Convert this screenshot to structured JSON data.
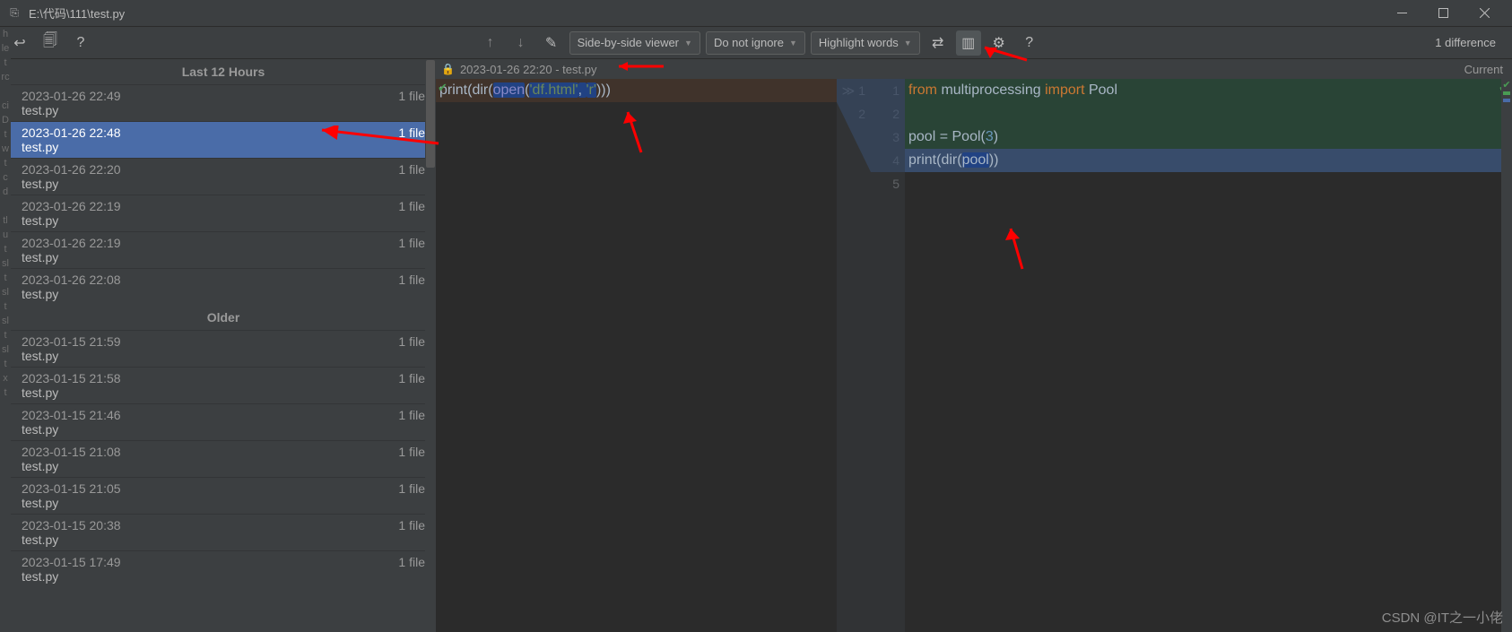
{
  "window": {
    "path": "E:\\代码\\111\\test.py"
  },
  "toolbar": {
    "viewer_mode": "Side-by-side viewer",
    "ignore_mode": "Do not ignore",
    "highlight_mode": "Highlight words",
    "diff_count": "1 difference"
  },
  "history": {
    "sections": [
      {
        "title": "Last 12 Hours",
        "items": [
          {
            "time": "2023-01-26 22:49",
            "files": "1 file",
            "name": "test.py",
            "selected": false
          },
          {
            "time": "2023-01-26 22:48",
            "files": "1 file",
            "name": "test.py",
            "selected": true
          },
          {
            "time": "2023-01-26 22:20",
            "files": "1 file",
            "name": "test.py",
            "selected": false
          },
          {
            "time": "2023-01-26 22:19",
            "files": "1 file",
            "name": "test.py",
            "selected": false
          },
          {
            "time": "2023-01-26 22:19",
            "files": "1 file",
            "name": "test.py",
            "selected": false
          },
          {
            "time": "2023-01-26 22:08",
            "files": "1 file",
            "name": "test.py",
            "selected": false
          }
        ]
      },
      {
        "title": "Older",
        "items": [
          {
            "time": "2023-01-15 21:59",
            "files": "1 file",
            "name": "test.py",
            "selected": false
          },
          {
            "time": "2023-01-15 21:58",
            "files": "1 file",
            "name": "test.py",
            "selected": false
          },
          {
            "time": "2023-01-15 21:46",
            "files": "1 file",
            "name": "test.py",
            "selected": false
          },
          {
            "time": "2023-01-15 21:08",
            "files": "1 file",
            "name": "test.py",
            "selected": false
          },
          {
            "time": "2023-01-15 21:05",
            "files": "1 file",
            "name": "test.py",
            "selected": false
          },
          {
            "time": "2023-01-15 20:38",
            "files": "1 file",
            "name": "test.py",
            "selected": false
          },
          {
            "time": "2023-01-15 17:49",
            "files": "1 file",
            "name": "test.py",
            "selected": false
          }
        ]
      }
    ]
  },
  "diff": {
    "left_label": "2023-01-26 22:20 - test.py",
    "right_label": "Current",
    "left_lines": {
      "1": {
        "tokens": [
          {
            "t": "print",
            "c": "builtin"
          },
          {
            "t": "(",
            "c": "txt"
          },
          {
            "t": "dir",
            "c": "builtin"
          },
          {
            "t": "(",
            "c": "txt"
          },
          {
            "t": "open",
            "c": "fn",
            "hl": true
          },
          {
            "t": "(",
            "c": "txt"
          },
          {
            "t": "'df.html'",
            "c": "str",
            "hl": true
          },
          {
            "t": ", ",
            "c": "txt",
            "hl": true
          },
          {
            "t": "'r'",
            "c": "str",
            "hl": true
          },
          {
            "t": ")",
            "c": "txt"
          },
          {
            "t": ")) ",
            "c": "txt"
          }
        ],
        "bg": "delbg"
      }
    },
    "right_lines": {
      "1": {
        "tokens": [
          {
            "t": "from ",
            "c": "kw"
          },
          {
            "t": "multiprocessing ",
            "c": "txt"
          },
          {
            "t": "import ",
            "c": "kw"
          },
          {
            "t": "Pool",
            "c": "txt"
          }
        ],
        "bg": "addbg"
      },
      "2": {
        "tokens": [
          {
            "t": "",
            "c": "txt"
          }
        ],
        "bg": "addbg"
      },
      "3": {
        "tokens": [
          {
            "t": "pool ",
            "c": "txt"
          },
          {
            "t": "= ",
            "c": "txt"
          },
          {
            "t": "Pool(",
            "c": "txt"
          },
          {
            "t": "3",
            "c": "num"
          },
          {
            "t": ")",
            "c": "txt"
          }
        ],
        "bg": "addbg"
      },
      "4": {
        "tokens": [
          {
            "t": "print",
            "c": "builtin"
          },
          {
            "t": "(",
            "c": "txt"
          },
          {
            "t": "dir",
            "c": "builtin"
          },
          {
            "t": "(",
            "c": "txt"
          },
          {
            "t": "pool",
            "c": "txt",
            "hl": true
          },
          {
            "t": "))",
            "c": "txt"
          }
        ],
        "bg": "addhl"
      },
      "5": {
        "tokens": [
          {
            "t": "",
            "c": "txt"
          }
        ],
        "bg": ""
      }
    },
    "left_gutter": [
      "1",
      "2"
    ],
    "right_gutter": [
      "1",
      "2",
      "3",
      "4",
      "5"
    ]
  },
  "watermark": "CSDN @IT之一小佬"
}
